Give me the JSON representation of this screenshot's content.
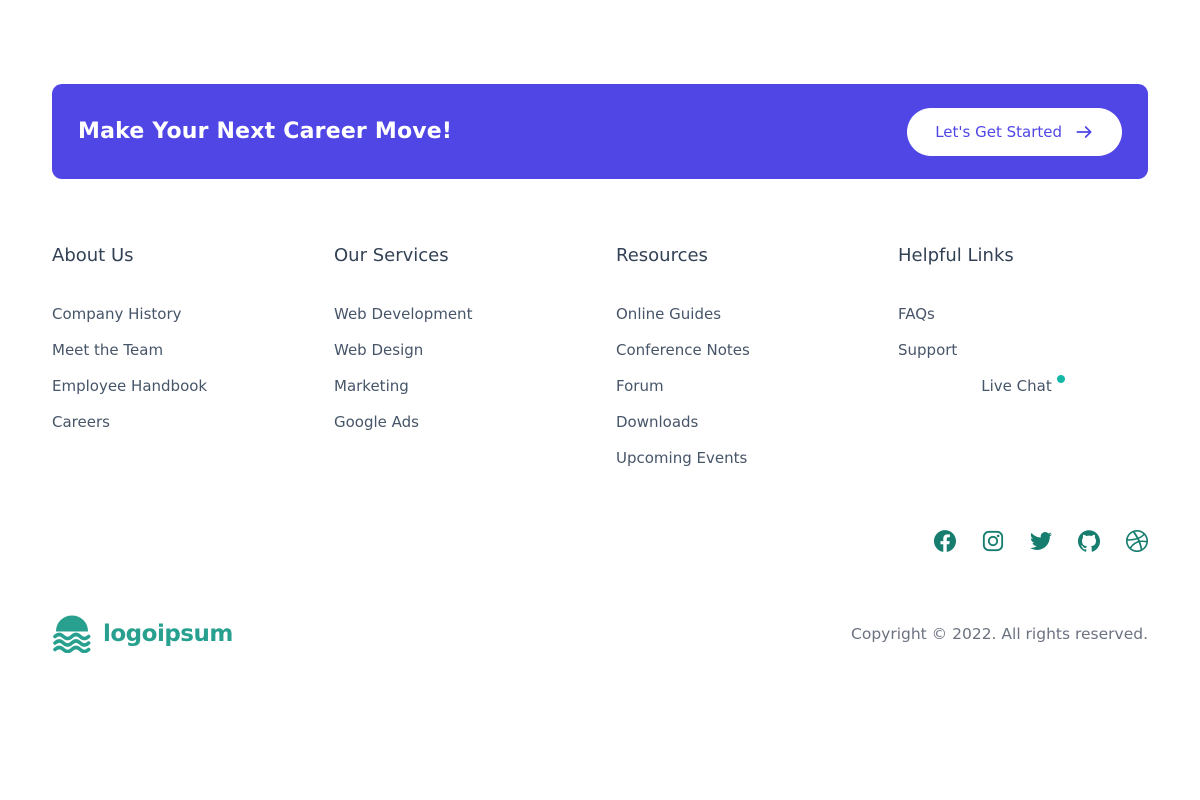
{
  "cta": {
    "title": "Make Your Next Career Move!",
    "button_label": "Let's Get Started",
    "background_color": "#4f46e5"
  },
  "columns": [
    {
      "heading": "About Us",
      "links": [
        "Company History",
        "Meet the Team",
        "Employee Handbook",
        "Careers"
      ]
    },
    {
      "heading": "Our Services",
      "links": [
        "Web Development",
        "Web Design",
        "Marketing",
        "Google Ads"
      ]
    },
    {
      "heading": "Resources",
      "links": [
        "Online Guides",
        "Conference Notes",
        "Forum",
        "Downloads",
        "Upcoming Events"
      ]
    },
    {
      "heading": "Helpful Links",
      "links": [
        "FAQs",
        "Support",
        "Live Chat"
      ],
      "live_chat_indicator_color": "#14b8a6"
    }
  ],
  "social": {
    "icon_color": "#177d6e",
    "icons": [
      "facebook-icon",
      "instagram-icon",
      "twitter-icon",
      "github-icon",
      "dribbble-icon"
    ]
  },
  "footer": {
    "logo_text": "logoipsum",
    "logo_color": "#28a08f",
    "copyright": "Copyright © 2022. All rights reserved."
  }
}
